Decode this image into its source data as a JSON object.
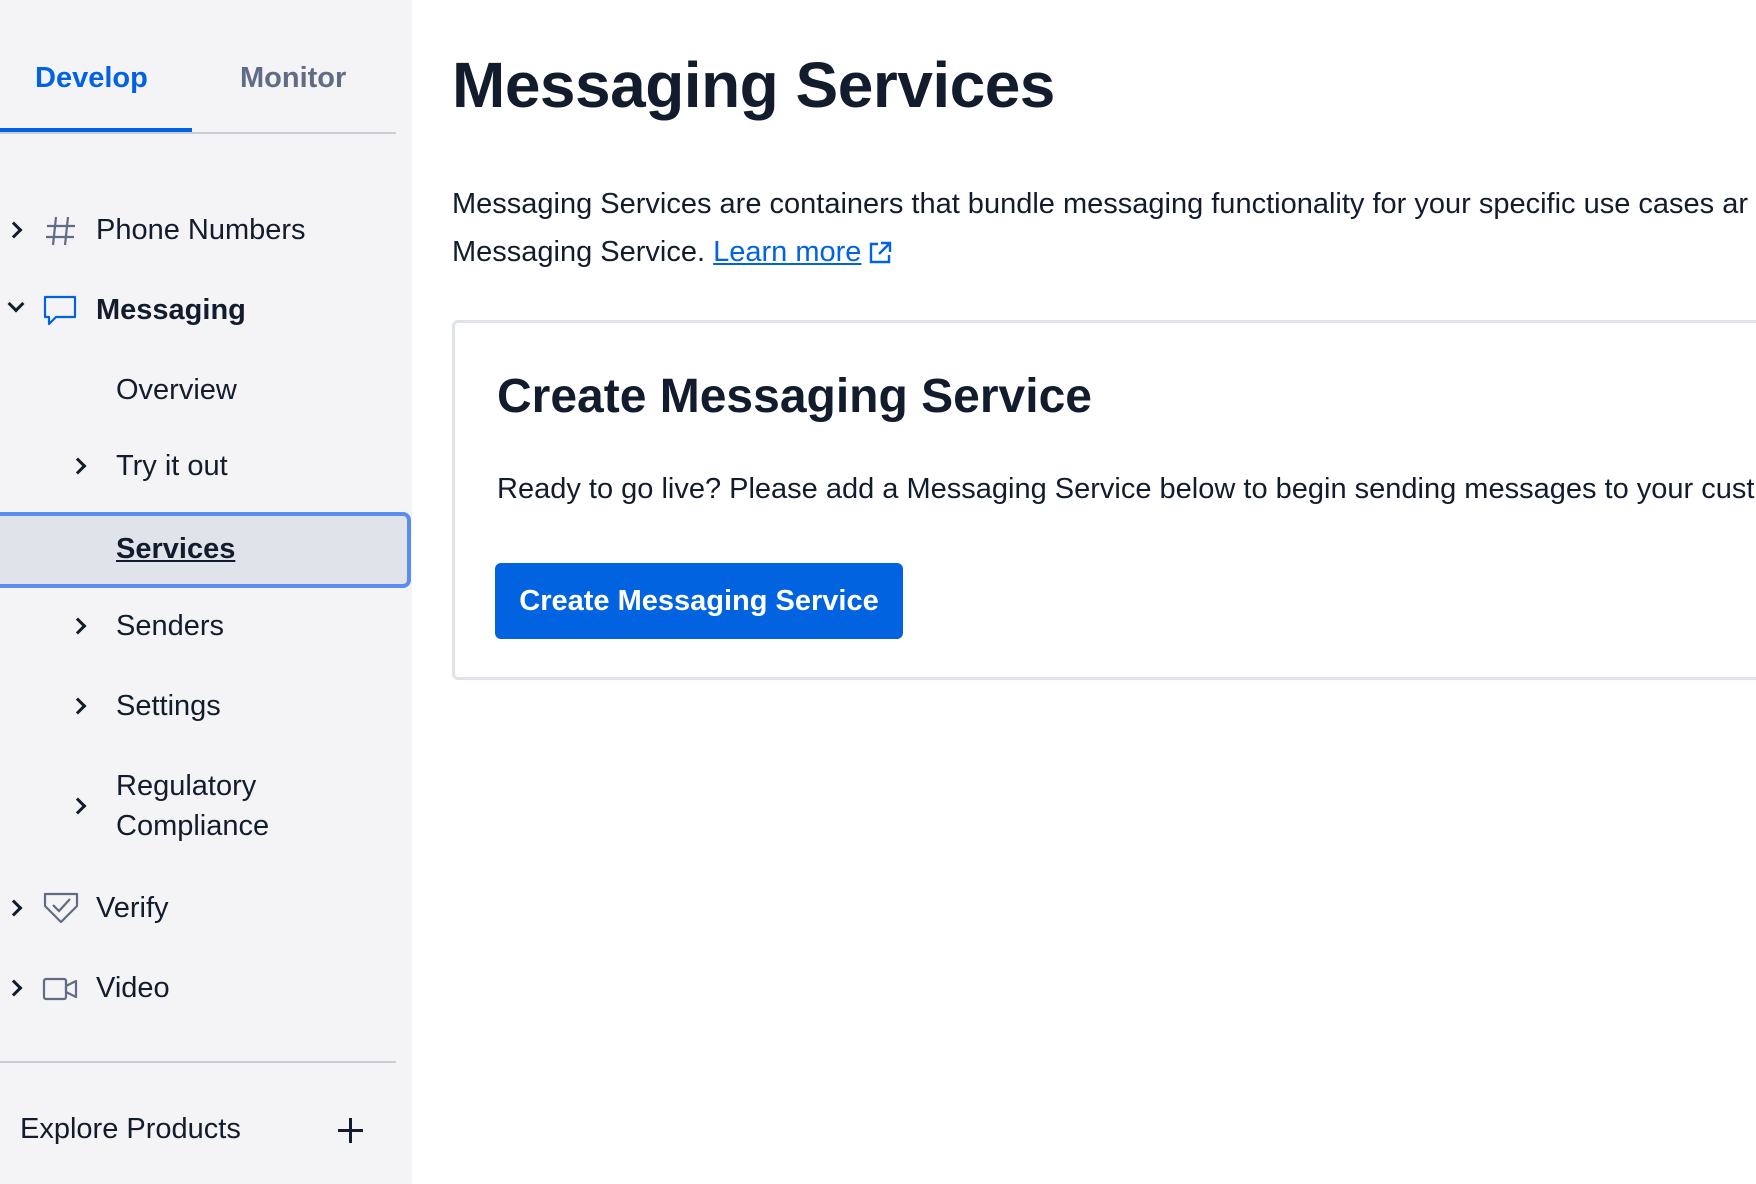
{
  "sidebar": {
    "tabs": [
      {
        "label": "Develop",
        "active": true
      },
      {
        "label": "Monitor",
        "active": false
      }
    ],
    "nav": {
      "phone_numbers": {
        "label": "Phone Numbers",
        "icon": "hash-icon"
      },
      "messaging": {
        "label": "Messaging",
        "icon": "chat-bubble-icon",
        "expanded": true
      },
      "overview": {
        "label": "Overview"
      },
      "try_it_out": {
        "label": "Try it out"
      },
      "services": {
        "label": "Services",
        "selected": true
      },
      "senders": {
        "label": "Senders"
      },
      "settings": {
        "label": "Settings"
      },
      "regulatory_line1": "Regulatory",
      "regulatory_line2": "Compliance",
      "verify": {
        "label": "Verify",
        "icon": "verify-check-icon"
      },
      "video": {
        "label": "Video",
        "icon": "video-camera-icon"
      }
    },
    "explore_label": "Explore Products"
  },
  "main": {
    "title": "Messaging Services",
    "description_line1": "Messaging Services are containers that bundle messaging functionality for your specific use cases ar",
    "description_line2_prefix": "Messaging Service. ",
    "learn_more": "Learn more",
    "card": {
      "title": "Create Messaging Service",
      "text": "Ready to go live? Please add a Messaging Service below to begin sending messages to your cust",
      "button_label": "Create Messaging Service"
    }
  },
  "colors": {
    "accent": "#0263e0",
    "sidebar_bg": "#f4f4f6",
    "text": "#121c2d",
    "selected_border": "#5b8def"
  }
}
